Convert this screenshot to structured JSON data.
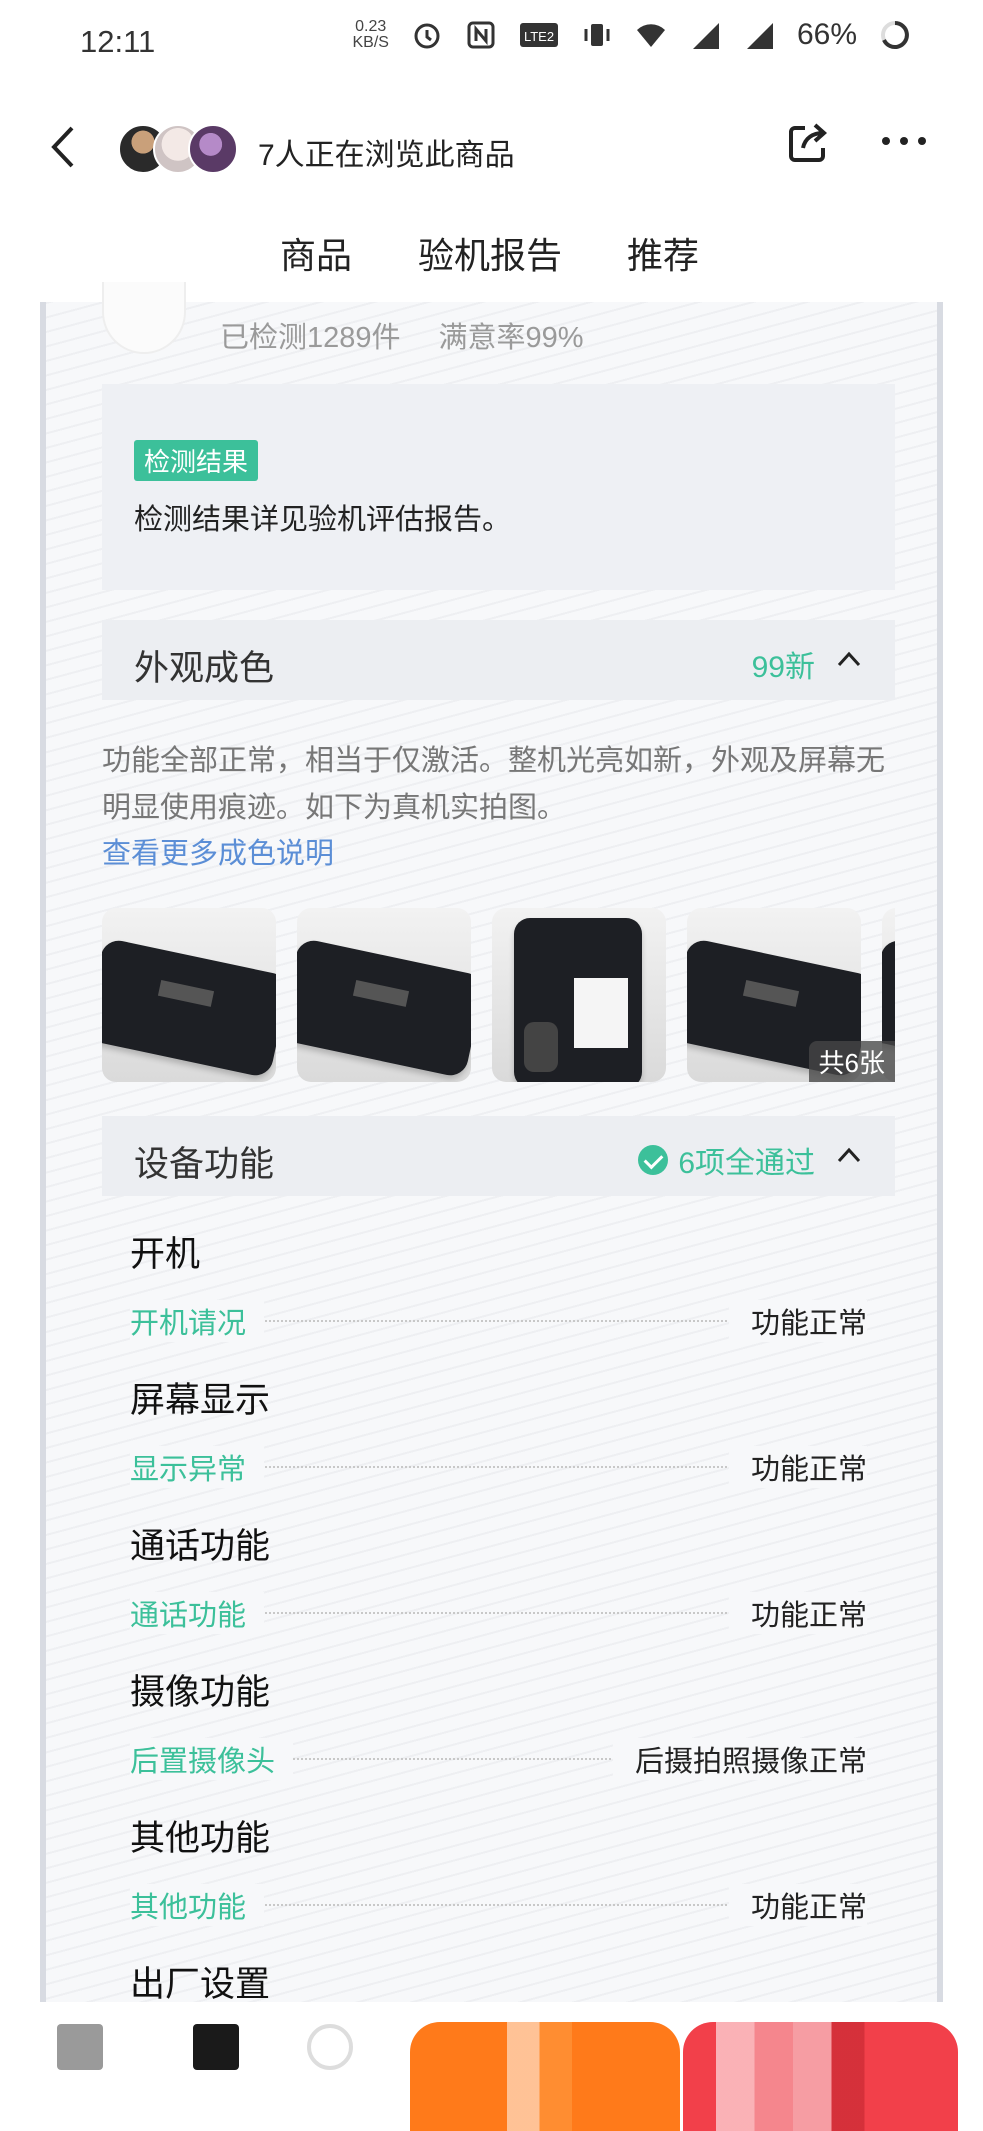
{
  "status_bar": {
    "time": "12:11",
    "speed_value": "0.23",
    "speed_unit": "KB/S",
    "battery": "66%"
  },
  "header": {
    "viewers_text": "7人正在浏览此商品"
  },
  "tabs": [
    {
      "label": "商品",
      "active": false
    },
    {
      "label": "验机报告",
      "active": true
    },
    {
      "label": "推荐",
      "active": false
    }
  ],
  "inspector": {
    "checked": "已检测1289件",
    "satisfaction": "满意率99%"
  },
  "result": {
    "badge": "检测结果",
    "text": "检测结果详见验机评估报告。"
  },
  "appearance": {
    "title": "外观成色",
    "grade": "99新",
    "description": "功能全部正常，相当于仅激活。整机光亮如新，外观及屏幕无明显使用痕迹。如下为真机实拍图。",
    "more_link": "查看更多成色说明",
    "photo_count": "共6张"
  },
  "functions": {
    "title": "设备功能",
    "summary": "6项全通过",
    "groups": [
      {
        "title": "开机",
        "key": "开机请况",
        "value": "功能正常"
      },
      {
        "title": "屏幕显示",
        "key": "显示异常",
        "value": "功能正常"
      },
      {
        "title": "通话功能",
        "key": "通话功能",
        "value": "功能正常"
      },
      {
        "title": "摄像功能",
        "key": "后置摄像头",
        "value": "后摄拍照摄像正常"
      },
      {
        "title": "其他功能",
        "key": "其他功能",
        "value": "功能正常"
      },
      {
        "title": "出厂设置"
      }
    ]
  },
  "colors": {
    "accent_green": "#3cc09a",
    "tab_indicator": "#f2404a",
    "link_blue": "#5b8ed6",
    "buy_orange": "#ff7a1a",
    "buy_red": "#f2404a"
  }
}
